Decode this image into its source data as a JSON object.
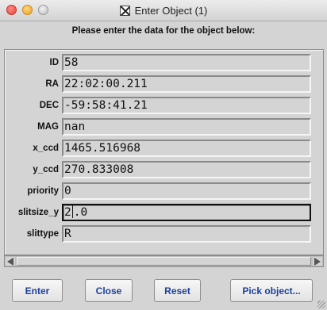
{
  "window": {
    "title": "Enter Object (1)",
    "instruction": "Please enter the data for the object below:"
  },
  "fields": [
    {
      "label": "ID",
      "value": "58"
    },
    {
      "label": "RA",
      "value": "22:02:00.211"
    },
    {
      "label": "DEC",
      "value": "-59:58:41.21"
    },
    {
      "label": "MAG",
      "value": "nan"
    },
    {
      "label": "x_ccd",
      "value": "1465.516968"
    },
    {
      "label": "y_ccd",
      "value": "270.833008"
    },
    {
      "label": "priority",
      "value": "0"
    },
    {
      "label": "slitsize_y",
      "value_before_cursor": "2",
      "value_after_cursor": ".0"
    },
    {
      "label": "slittype",
      "value": "R"
    }
  ],
  "buttons": {
    "enter": "Enter",
    "close": "Close",
    "reset": "Reset",
    "pick": "Pick object..."
  },
  "icons": {
    "window_close": "close-traffic-light",
    "window_minimize": "minimize-traffic-light",
    "window_maximize": "maximize-traffic-light",
    "app": "x11-icon"
  },
  "colors": {
    "button_text": "#1c3f9c",
    "background": "#d4d4d4"
  }
}
